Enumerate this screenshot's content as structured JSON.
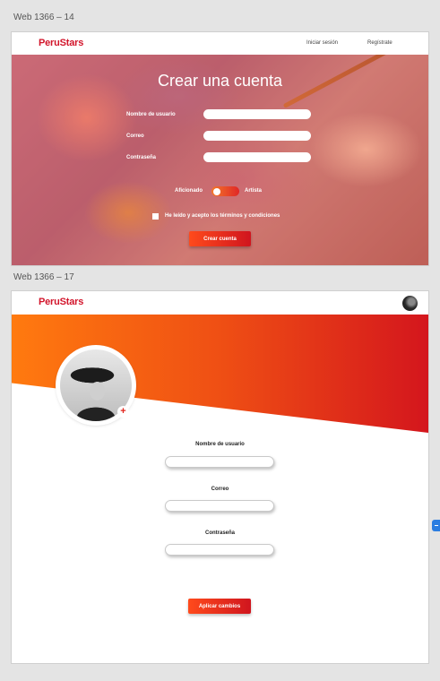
{
  "artboards": [
    {
      "label": "Web 1366 – 14",
      "nav": {
        "logo": "PeruStars",
        "login": "Iniciar sesión",
        "register": "Regístrate"
      },
      "hero": {
        "title": "Crear una cuenta",
        "fields": [
          {
            "label": "Nombre de usuario",
            "value": ""
          },
          {
            "label": "Correo",
            "value": ""
          },
          {
            "label": "Contraseña",
            "value": ""
          }
        ],
        "toggle": {
          "left_label": "Aficionado",
          "right_label": "Artista"
        },
        "terms_label": "He leído y acepto los términos y condiciones",
        "terms_checked": false,
        "submit_label": "Crear cuenta"
      }
    },
    {
      "label": "Web 1366 – 17",
      "nav": {
        "logo": "PeruStars"
      },
      "add_photo_symbol": "+",
      "fields": [
        {
          "label": "Nombre de usuario",
          "value": ""
        },
        {
          "label": "Correo",
          "value": ""
        },
        {
          "label": "Contraseña",
          "value": ""
        }
      ],
      "submit_label": "Aplicar cambios"
    }
  ],
  "colors": {
    "brand_red": "#d2152b",
    "gradient_start": "#ff7a0f",
    "gradient_end": "#d4161d",
    "canvas_bg": "#e4e4e4"
  },
  "icons": {
    "profile_avatar": "avatar-icon",
    "add_photo": "plus-icon",
    "side_handle": "panel-handle-icon"
  }
}
